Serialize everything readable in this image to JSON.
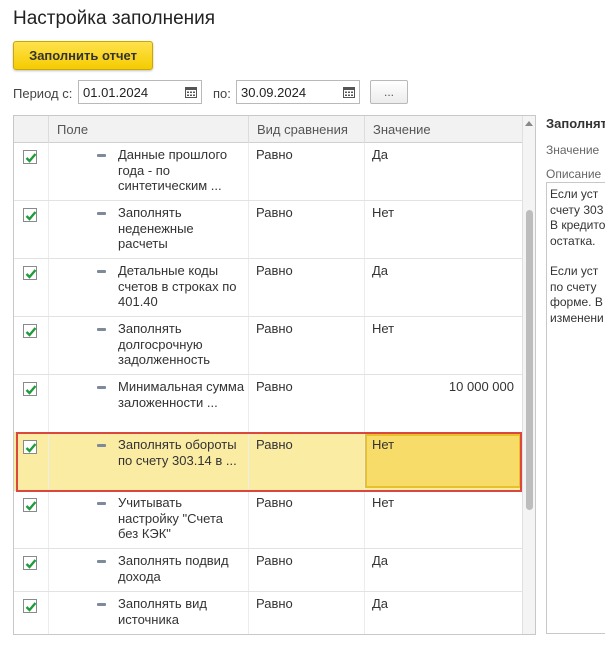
{
  "page": {
    "title": "Настройка заполнения",
    "fill_button": "Заполнить отчет",
    "period_label": "Период с:",
    "to_label": "по:",
    "date_from": "01.01.2024",
    "date_to": "30.09.2024",
    "dots_button": "..."
  },
  "table": {
    "headers": [
      "Поле",
      "Вид сравнения",
      "Значение"
    ],
    "rows": [
      {
        "field": "Данные прошлого года - по синтетическим ...",
        "cmp": "Равно",
        "value": "Да",
        "checked": true
      },
      {
        "field": "Заполнять неденежные расчеты",
        "cmp": "Равно",
        "value": "Нет",
        "checked": true
      },
      {
        "field": "Детальные коды счетов в строках по 401.40",
        "cmp": "Равно",
        "value": "Да",
        "checked": true
      },
      {
        "field": "Заполнять долгосрочную задолженность",
        "cmp": "Равно",
        "value": "Нет",
        "checked": true
      },
      {
        "field": "Минимальная сумма заложенности ...",
        "cmp": "Равно",
        "value": "10 000 000",
        "checked": true
      },
      {
        "field": "Заполнять обороты по счету 303.14 в ...",
        "cmp": "Равно",
        "value": "Нет",
        "checked": true,
        "selected": true
      },
      {
        "field": "Учитывать настройку \"Счета без КЭК\"",
        "cmp": "Равно",
        "value": "Нет",
        "checked": true
      },
      {
        "field": "Заполнять подвид дохода",
        "cmp": "Равно",
        "value": "Да",
        "checked": true
      },
      {
        "field": "Заполнять вид источника",
        "cmp": "Равно",
        "value": "Да",
        "checked": true
      }
    ]
  },
  "scrollbar": {
    "position_fraction": 0.4
  },
  "side_panel": {
    "title": "Заполнят",
    "value_label": "Значение",
    "description_label": "Описание",
    "description_lines": [
      "Если уст",
      "счету 303",
      "В кредито",
      "остатка.",
      "",
      "Если уст",
      "по счету",
      "форме. В",
      "изменени"
    ]
  },
  "colors": {
    "accent_button": "#f5cc00",
    "selected_row": "#fbeca4",
    "selected_cell": "#f7dc6a",
    "highlight_frame": "#d9473f",
    "checkbox_mark": "#1f9c3c"
  }
}
